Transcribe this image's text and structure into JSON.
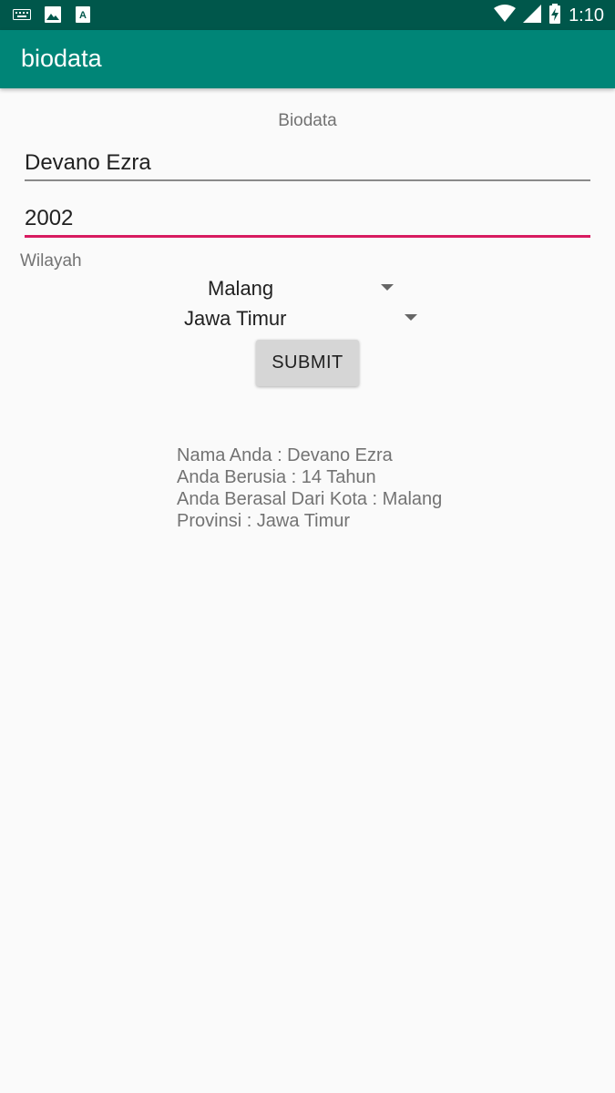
{
  "status_bar": {
    "time": "1:10",
    "icons_left": [
      "keyboard-icon",
      "image-icon",
      "font-icon"
    ],
    "icons_right": [
      "wifi-icon",
      "signal-icon",
      "battery-charging-icon"
    ]
  },
  "app_bar": {
    "title": "biodata",
    "color": "#008577"
  },
  "form": {
    "heading": "Biodata",
    "name_value": "Devano Ezra",
    "year_value": "2002",
    "region_label": "Wilayah",
    "city_selected": "Malang",
    "province_selected": "Jawa Timur",
    "submit_label": "SUBMIT",
    "accent_color": "#d81b60"
  },
  "result": {
    "lines": [
      "Nama Anda : Devano Ezra",
      "Anda Berusia : 14 Tahun",
      "Anda Berasal Dari Kota : Malang",
      "Provinsi : Jawa Timur"
    ]
  }
}
